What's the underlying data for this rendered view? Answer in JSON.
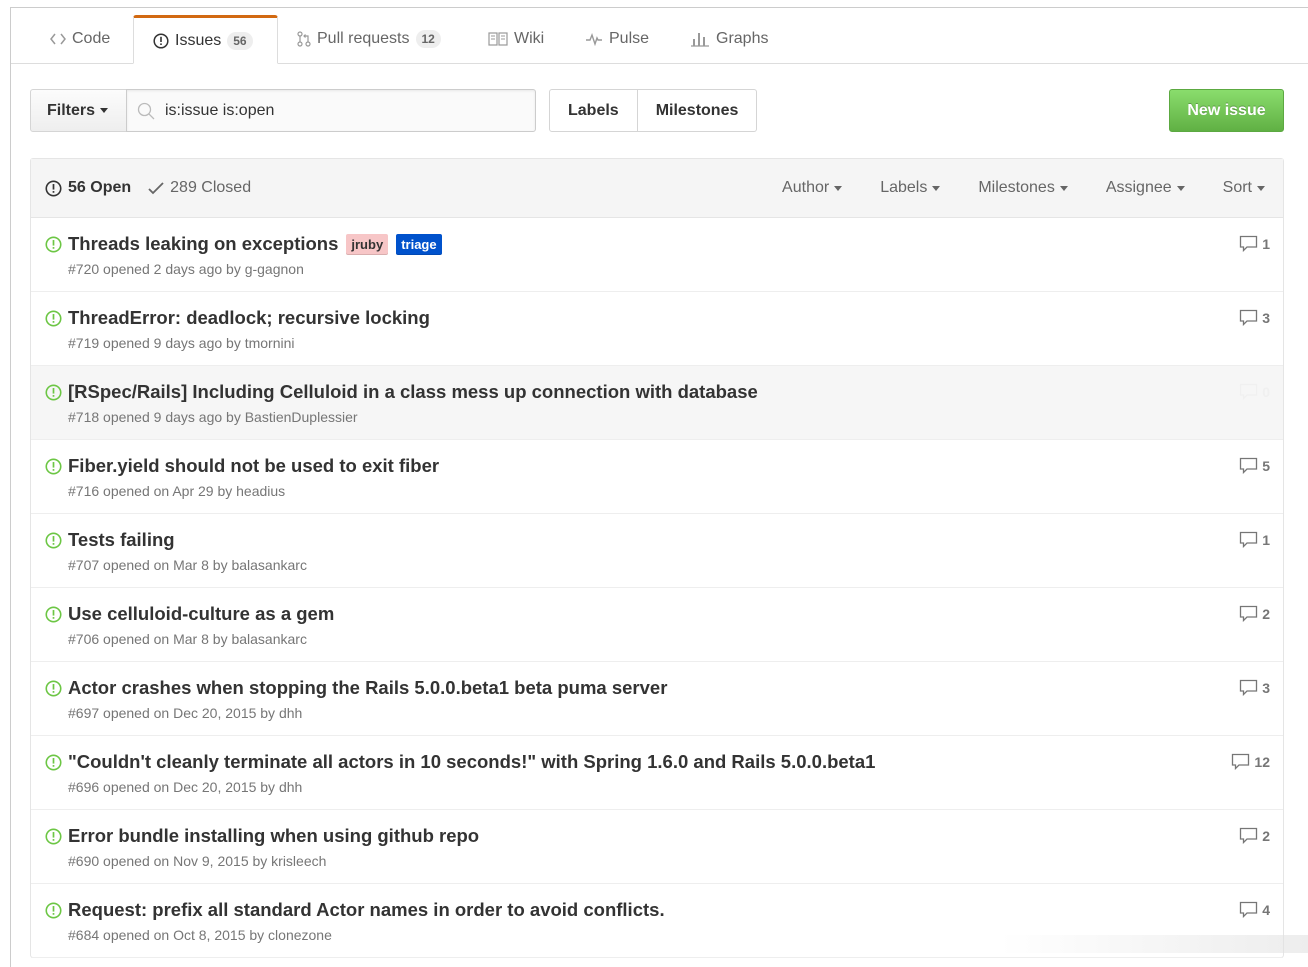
{
  "tabs": [
    {
      "label": "Code",
      "icon": "code-icon"
    },
    {
      "label": "Issues",
      "counter": "56",
      "icon": "issue-opened-icon"
    },
    {
      "label": "Pull requests",
      "counter": "12",
      "icon": "git-pull-request-icon"
    },
    {
      "label": "Wiki",
      "icon": "book-icon"
    },
    {
      "label": "Pulse",
      "icon": "pulse-icon"
    },
    {
      "label": "Graphs",
      "icon": "graph-icon"
    }
  ],
  "toolbar": {
    "filters_label": "Filters",
    "search_value": "is:issue is:open",
    "labels_label": "Labels",
    "milestones_label": "Milestones",
    "new_issue_label": "New issue"
  },
  "issues_header": {
    "open_label": "56 Open",
    "closed_label": "289 Closed",
    "menus": [
      "Author",
      "Labels",
      "Milestones",
      "Assignee",
      "Sort"
    ]
  },
  "colors": {
    "open_green": "#6cc644",
    "label_jruby_bg": "#f7c6c7",
    "label_jruby_fg": "#333333",
    "label_triage_bg": "#0052cc",
    "label_triage_fg": "#ffffff",
    "selected_tab_accent": "#d26911"
  },
  "issues": [
    {
      "title": "Threads leaking on exceptions",
      "meta": "#720 opened 2 days ago by g-gagnon",
      "comments": "1",
      "labels": [
        {
          "name": "jruby"
        },
        {
          "name": "triage"
        }
      ]
    },
    {
      "title": "ThreadError: deadlock; recursive locking",
      "meta": "#719 opened 9 days ago by tmornini",
      "comments": "3",
      "labels": []
    },
    {
      "title": "[RSpec/Rails] Including Celluloid in a class mess up connection with database",
      "meta": "#718 opened 9 days ago by BastienDuplessier",
      "comments": "0",
      "labels": []
    },
    {
      "title": "Fiber.yield should not be used to exit fiber",
      "meta": "#716 opened on Apr 29 by headius",
      "comments": "5",
      "labels": []
    },
    {
      "title": "Tests failing",
      "meta": "#707 opened on Mar 8 by balasankarc",
      "comments": "1",
      "labels": []
    },
    {
      "title": "Use celluloid-culture as a gem",
      "meta": "#706 opened on Mar 8 by balasankarc",
      "comments": "2",
      "labels": []
    },
    {
      "title": "Actor crashes when stopping the Rails 5.0.0.beta1 beta puma server",
      "meta": "#697 opened on Dec 20, 2015 by dhh",
      "comments": "3",
      "labels": []
    },
    {
      "title": "\"Couldn't cleanly terminate all actors in 10 seconds!\" with Spring 1.6.0 and Rails 5.0.0.beta1",
      "meta": "#696 opened on Dec 20, 2015 by dhh",
      "comments": "12",
      "labels": []
    },
    {
      "title": "Error bundle installing when using github repo",
      "meta": "#690 opened on Nov 9, 2015 by krisleech",
      "comments": "2",
      "labels": []
    },
    {
      "title": "Request: prefix all standard Actor names in order to avoid conflicts.",
      "meta": "#684 opened on Oct 8, 2015 by clonezone",
      "comments": "4",
      "labels": []
    }
  ]
}
